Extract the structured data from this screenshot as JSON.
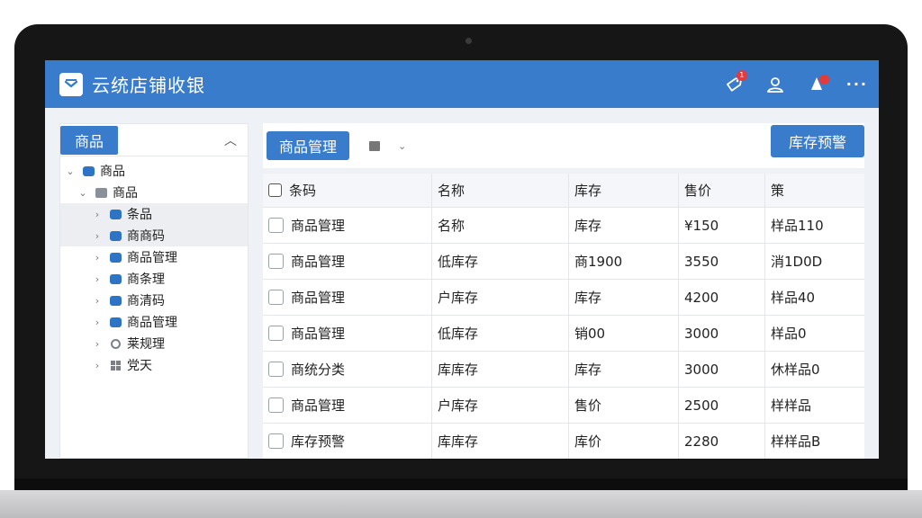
{
  "app": {
    "title": "云统店铺收银",
    "notification_count": "1"
  },
  "sidebar": {
    "header_label": "商品",
    "tree": [
      {
        "label": "商品",
        "icon": "database-icon",
        "expanded": true,
        "level": 0
      },
      {
        "label": "商品",
        "icon": "folder-icon",
        "expanded": true,
        "level": 1
      },
      {
        "label": "条品",
        "icon": "database-icon",
        "expanded": false,
        "level": 2
      },
      {
        "label": "商商码",
        "icon": "database-icon",
        "expanded": false,
        "level": 2
      },
      {
        "label": "商品管理",
        "icon": "database-icon",
        "expanded": false,
        "level": 2
      },
      {
        "label": "商条理",
        "icon": "database-icon",
        "expanded": false,
        "level": 2
      },
      {
        "label": "商清码",
        "icon": "database-icon",
        "expanded": false,
        "level": 2
      },
      {
        "label": "商品管理",
        "icon": "database-icon",
        "expanded": false,
        "level": 2
      },
      {
        "label": "莱规理",
        "icon": "gauge-icon",
        "expanded": false,
        "level": 2
      },
      {
        "label": "党天",
        "icon": "grid-icon",
        "expanded": false,
        "level": 2
      }
    ]
  },
  "toolbar": {
    "manage_button": "商品管理",
    "stock_alert_button": "库存预警"
  },
  "table": {
    "columns": [
      "条码",
      "名称",
      "库存",
      "售价",
      "策"
    ],
    "rows": [
      [
        "商品管理",
        "名称",
        "库存",
        "¥150",
        "样品110"
      ],
      [
        "商品管理",
        "低库存",
        "商1900",
        "3550",
        "消1D0D"
      ],
      [
        "商品管理",
        "户库存",
        "库存",
        "4200",
        "样品40"
      ],
      [
        "商品管理",
        "低库存",
        "销00",
        "3000",
        "样品0"
      ],
      [
        "商统分类",
        "库库存",
        "库存",
        "3000",
        "休样品0"
      ],
      [
        "商品管理",
        "户库存",
        "售价",
        "2500",
        "样样品"
      ],
      [
        "库存预警",
        "库库存",
        "库价",
        "2280",
        "样样品B"
      ]
    ]
  },
  "colors": {
    "accent": "#3a7ccc",
    "badge": "#e23b3b"
  }
}
